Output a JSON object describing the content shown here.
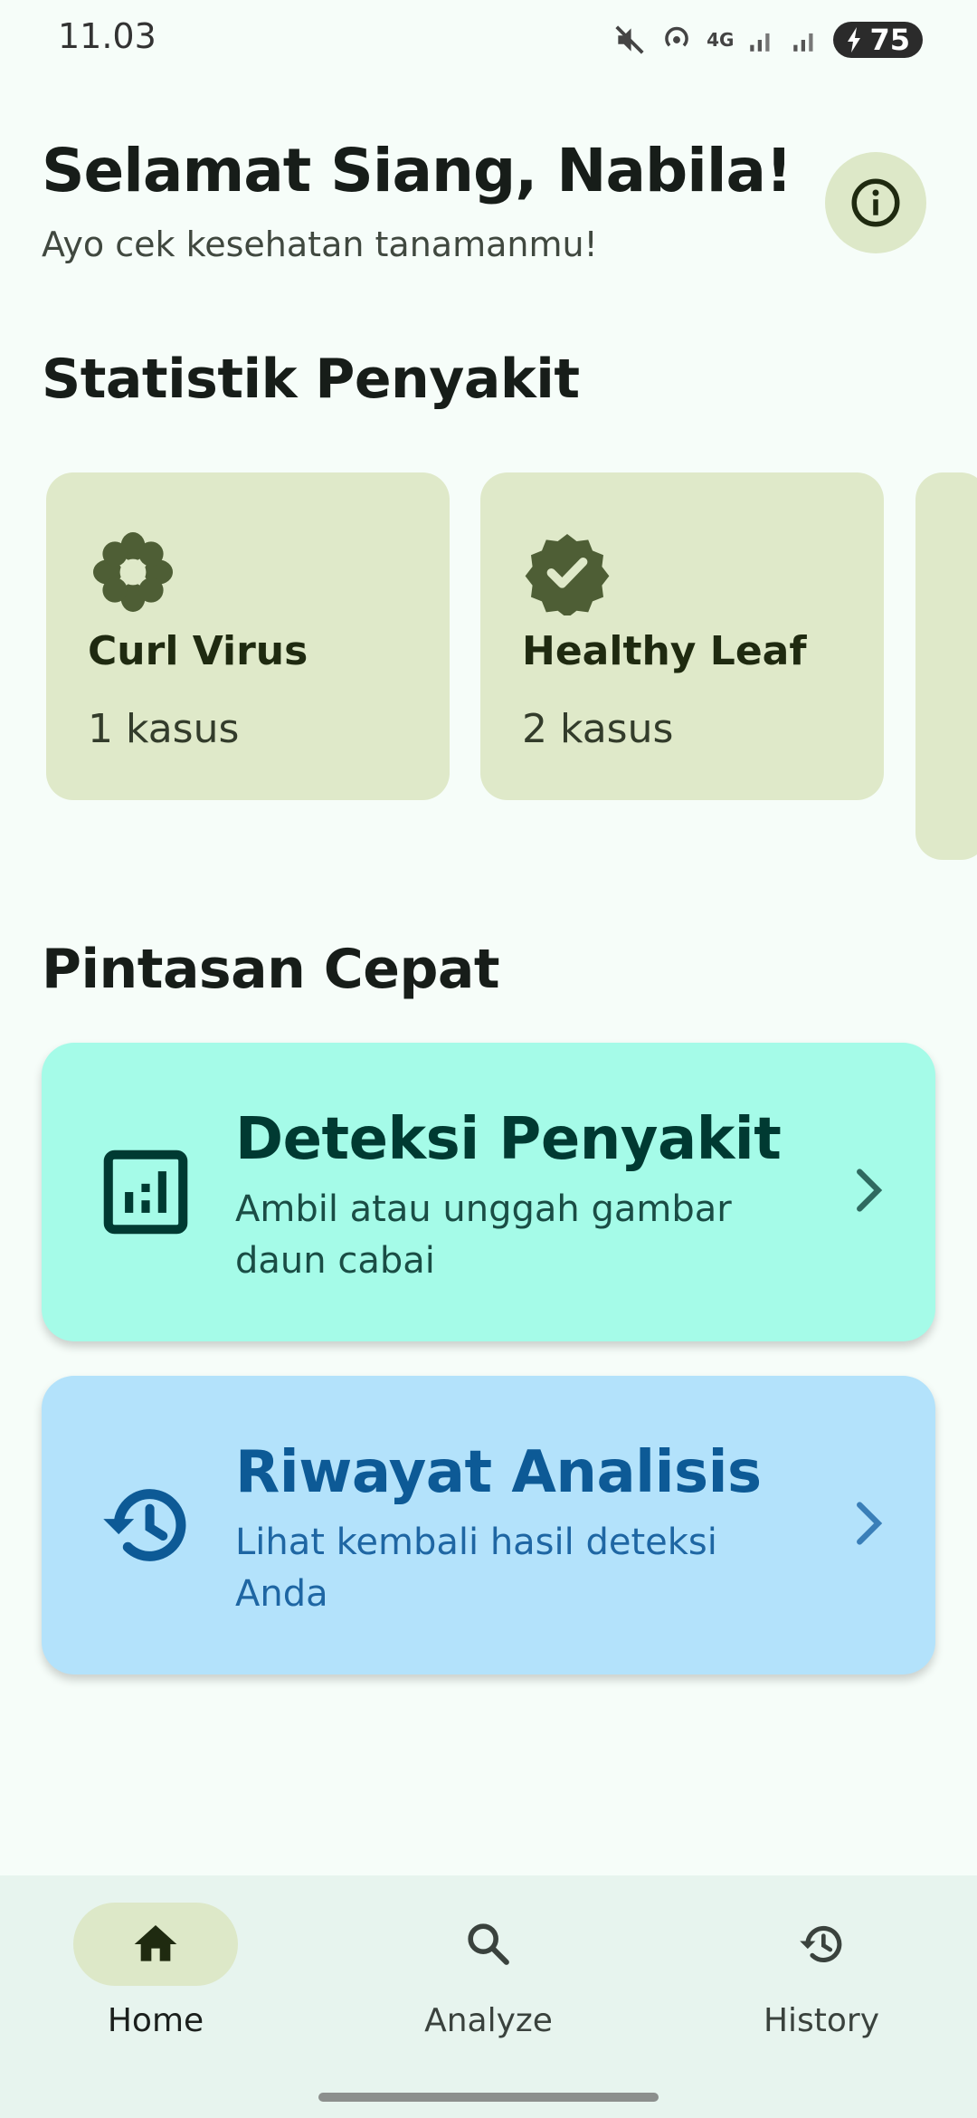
{
  "status_bar": {
    "time": "11.03",
    "battery": "75",
    "network": "4G"
  },
  "header": {
    "greeting": "Selamat Siang, Nabila!",
    "subtitle": "Ayo cek kesehatan tanamanmu!",
    "info_icon": "info-icon"
  },
  "stats": {
    "title": "Statistik Penyakit",
    "cards": [
      {
        "name": "Curl Virus",
        "count": "1 kasus",
        "icon": "flower-icon"
      },
      {
        "name": "Healthy Leaf",
        "count": "2 kasus",
        "icon": "verified-badge-icon"
      }
    ]
  },
  "shortcuts": {
    "title": "Pintasan Cepat",
    "items": [
      {
        "title": "Deteksi Penyakit",
        "description": "Ambil atau unggah gambar daun cabai",
        "icon": "analytics-icon",
        "bg": "#a5fbe8",
        "fg": "#003a32"
      },
      {
        "title": "Riwayat Analisis",
        "description": "Lihat kembali hasil deteksi Anda",
        "icon": "history-icon",
        "bg": "#b3e2fb",
        "fg": "#0d5a96"
      }
    ]
  },
  "bottom_nav": {
    "items": [
      {
        "label": "Home",
        "icon": "home-icon",
        "active": true
      },
      {
        "label": "Analyze",
        "icon": "search-icon",
        "active": false
      },
      {
        "label": "History",
        "icon": "history-icon",
        "active": false
      }
    ]
  },
  "colors": {
    "background": "#f6fdf9",
    "stat_card": "#dfe9c9",
    "nav_bg": "#e7f4ee",
    "nav_active": "#dde8c8"
  }
}
